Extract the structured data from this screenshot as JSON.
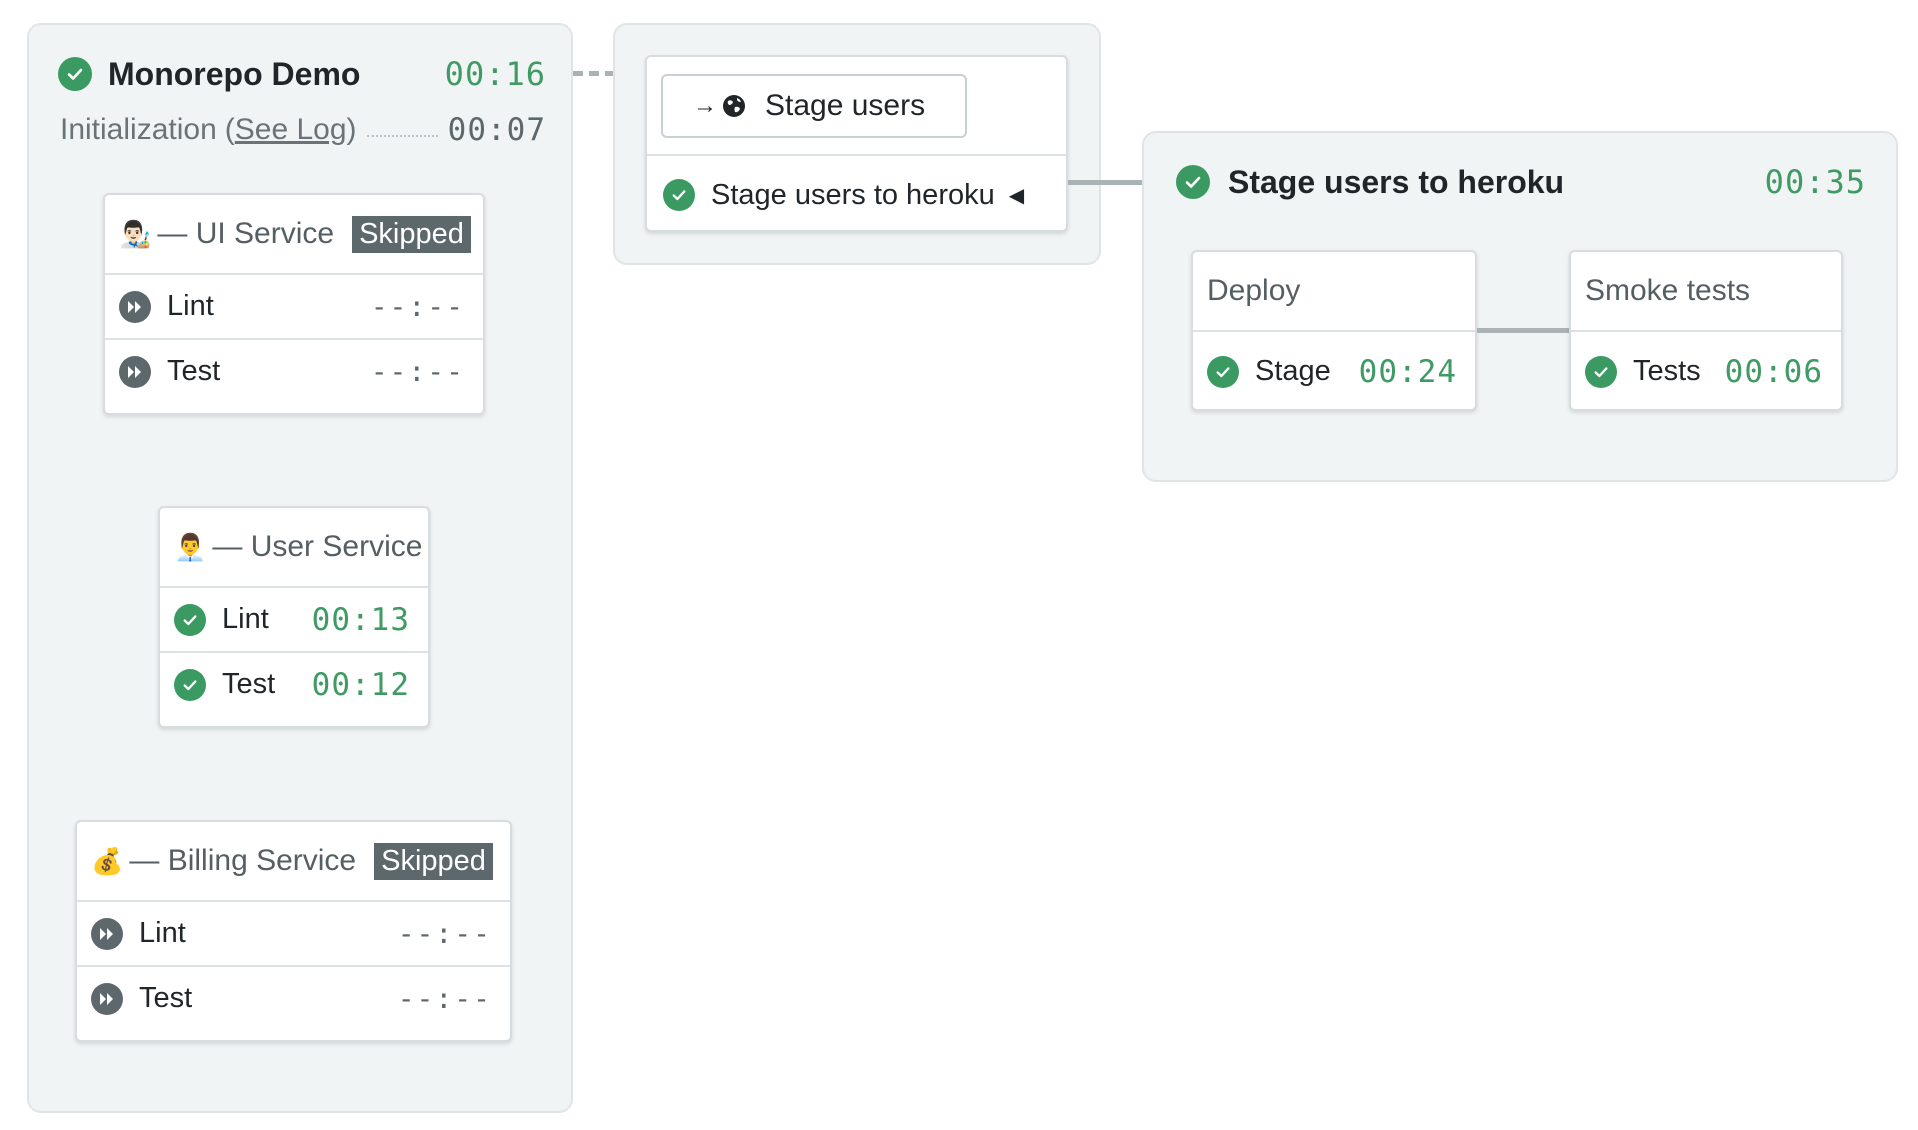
{
  "main_block": {
    "title": "Monorepo Demo",
    "duration": "00:16",
    "init_label": "Initialization",
    "see_log_label": "See Log",
    "init_duration": "00:07",
    "status": "passed"
  },
  "blocks": [
    {
      "emoji": "👨🏻‍🎨",
      "name": "— UI Service",
      "badge": "Skipped",
      "jobs": [
        {
          "name": "Lint",
          "duration": "--:--",
          "status": "skipped"
        },
        {
          "name": "Test",
          "duration": "--:--",
          "status": "skipped"
        }
      ]
    },
    {
      "emoji": "👨‍💼",
      "name": "— User Service",
      "badge": "",
      "jobs": [
        {
          "name": "Lint",
          "duration": "00:13",
          "status": "passed"
        },
        {
          "name": "Test",
          "duration": "00:12",
          "status": "passed"
        }
      ]
    },
    {
      "emoji": "💰",
      "name": "— Billing Service",
      "badge": "Skipped",
      "jobs": [
        {
          "name": "Lint",
          "duration": "--:--",
          "status": "skipped"
        },
        {
          "name": "Test",
          "duration": "--:--",
          "status": "skipped"
        }
      ]
    }
  ],
  "promotion": {
    "button_label": "Stage users",
    "target_label": "Stage users to heroku"
  },
  "stage_pipeline": {
    "title": "Stage users to heroku",
    "duration": "00:35",
    "status": "passed",
    "blocks": [
      {
        "name": "Deploy",
        "jobs": [
          {
            "name": "Stage",
            "duration": "00:24",
            "status": "passed"
          }
        ]
      },
      {
        "name": "Smoke tests",
        "jobs": [
          {
            "name": "Tests",
            "duration": "00:06",
            "status": "passed"
          }
        ]
      }
    ]
  },
  "colors": {
    "passed": "#3a9a61",
    "skipped": "#5d686c",
    "panel": "#f1f4f5"
  }
}
